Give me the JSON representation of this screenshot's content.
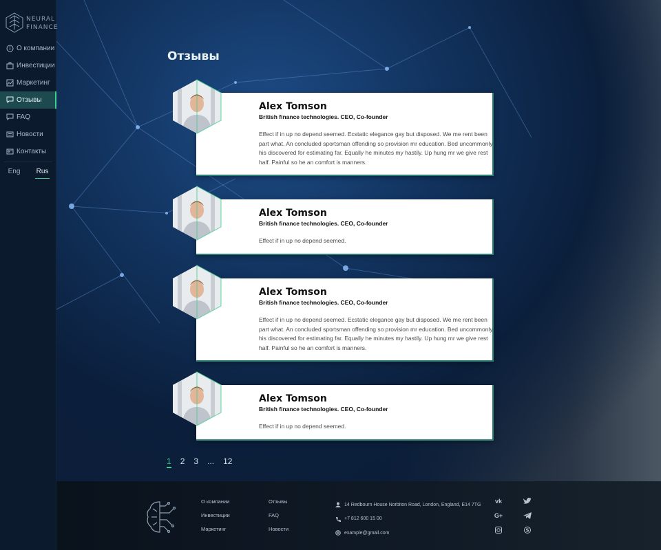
{
  "brand": {
    "line1": "NEURAL",
    "line2": "FINANCE"
  },
  "nav": [
    {
      "label": "О компании",
      "icon": "info-icon",
      "active": false
    },
    {
      "label": "Инвестиции",
      "icon": "briefcase-icon",
      "active": false
    },
    {
      "label": "Маркетинг",
      "icon": "chart-icon",
      "active": false
    },
    {
      "label": "Отзывы",
      "icon": "comment-icon",
      "active": true
    },
    {
      "label": "FAQ",
      "icon": "faq-icon",
      "active": false
    },
    {
      "label": "Новости",
      "icon": "news-icon",
      "active": false
    },
    {
      "label": "Контакты",
      "icon": "contacts-icon",
      "active": false
    }
  ],
  "lang": {
    "eng": "Eng",
    "rus": "Rus",
    "selected": "Rus"
  },
  "page": {
    "title": "Отзывы"
  },
  "reviews": [
    {
      "name": "Alex Tomson",
      "role": "British finance technologies. CEO, Co-founder",
      "text": "Effect if in up no depend seemed. Ecstatic elegance gay but disposed. We me rent been part what. An concluded sportsman offending so provision mr education. Bed uncommonly his discovered for estimating far. Equally he minutes my hastily. Up hung mr we give rest half. Painful so he an comfort is manners."
    },
    {
      "name": "Alex Tomson",
      "role": "British finance technologies. CEO, Co-founder",
      "text": "Effect if in up no depend seemed."
    },
    {
      "name": "Alex Tomson",
      "role": "British finance technologies. CEO, Co-founder",
      "text": "Effect if in up no depend seemed. Ecstatic elegance gay but disposed. We me rent been part what. An concluded sportsman offending so provision mr education. Bed uncommonly his discovered for estimating far. Equally he minutes my hastily. Up hung mr we give rest half. Painful so he an comfort is manners."
    },
    {
      "name": "Alex Tomson",
      "role": "British finance technologies. CEO, Co-founder",
      "text": "Effect if in up no depend seemed."
    }
  ],
  "pagination": {
    "pages": [
      "1",
      "2",
      "3",
      "...",
      "12"
    ],
    "current": "1"
  },
  "footer": {
    "col1": [
      "О компании",
      "Инвестиции",
      "Маркетинг"
    ],
    "col2": [
      "Отзывы",
      "FAQ",
      "Новости"
    ],
    "address": "14 Redbourn House Norbiton Road, London, England, E14 7TG",
    "phone": "+7 812 600 15 00",
    "email": "example@gmail.com",
    "social": [
      "vk-icon",
      "twitter-icon",
      "google-plus-icon",
      "telegram-icon",
      "instagram-icon",
      "skype-icon"
    ]
  },
  "colors": {
    "accent": "#3fcf8e",
    "sidebar": "#0b1a2d",
    "card_border": "#2a7f73"
  }
}
